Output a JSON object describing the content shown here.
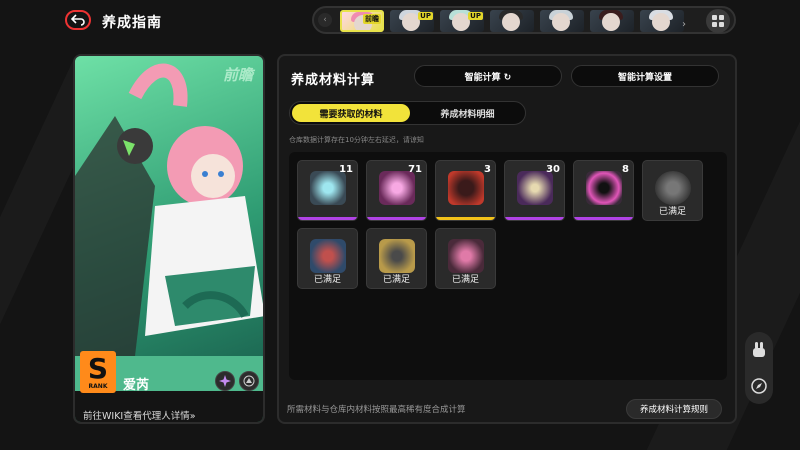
{
  "header": {
    "title": "养成指南",
    "roster": [
      {
        "name": "portrait-1",
        "tag": "前瞻",
        "selected": true
      },
      {
        "name": "portrait-2",
        "tag": "UP"
      },
      {
        "name": "portrait-3",
        "tag": "UP"
      },
      {
        "name": "portrait-4",
        "tag": ""
      },
      {
        "name": "portrait-5",
        "tag": ""
      },
      {
        "name": "portrait-6",
        "tag": ""
      },
      {
        "name": "portrait-7",
        "tag": ""
      }
    ]
  },
  "agent": {
    "preview_tag": "前瞻",
    "rank": "S",
    "rank_label": "RANK",
    "name": "爱芮",
    "wiki_link": "前往WIKI查看代理人详情»"
  },
  "calc": {
    "title": "养成材料计算",
    "smart_calc_label": "智能计算 ↻",
    "smart_settings_label": "智能计算设置",
    "tabs": [
      "需要获取的材料",
      "养成材料明细"
    ],
    "note": "仓库数据计算存在10分钟左右延迟，请谅知",
    "materials": [
      {
        "qty": "11",
        "status": "",
        "color": "#4bb5c4",
        "rarity": "#b143e6"
      },
      {
        "qty": "71",
        "status": "",
        "color": "#e85fc8",
        "rarity": "#b143e6"
      },
      {
        "qty": "3",
        "status": "",
        "color": "#6d2a2a",
        "rarity": "#f2c21a"
      },
      {
        "qty": "30",
        "status": "",
        "color": "#5a3a6a",
        "rarity": "#b143e6"
      },
      {
        "qty": "8",
        "status": "",
        "color": "#d23fa0",
        "rarity": "#b143e6"
      },
      {
        "qty": "",
        "status": "已满足",
        "color": "#555555",
        "rarity": ""
      },
      {
        "qty": "",
        "status": "已满足",
        "color": "#3a5f8a",
        "rarity": ""
      },
      {
        "qty": "",
        "status": "已满足",
        "color": "#8a7a3a",
        "rarity": ""
      },
      {
        "qty": "",
        "status": "已满足",
        "color": "#8a3a5a",
        "rarity": ""
      }
    ],
    "footer_note": "所需材料与仓库内材料按照最高稀有度合成计算",
    "rules_label": "养成材料计算规则"
  }
}
